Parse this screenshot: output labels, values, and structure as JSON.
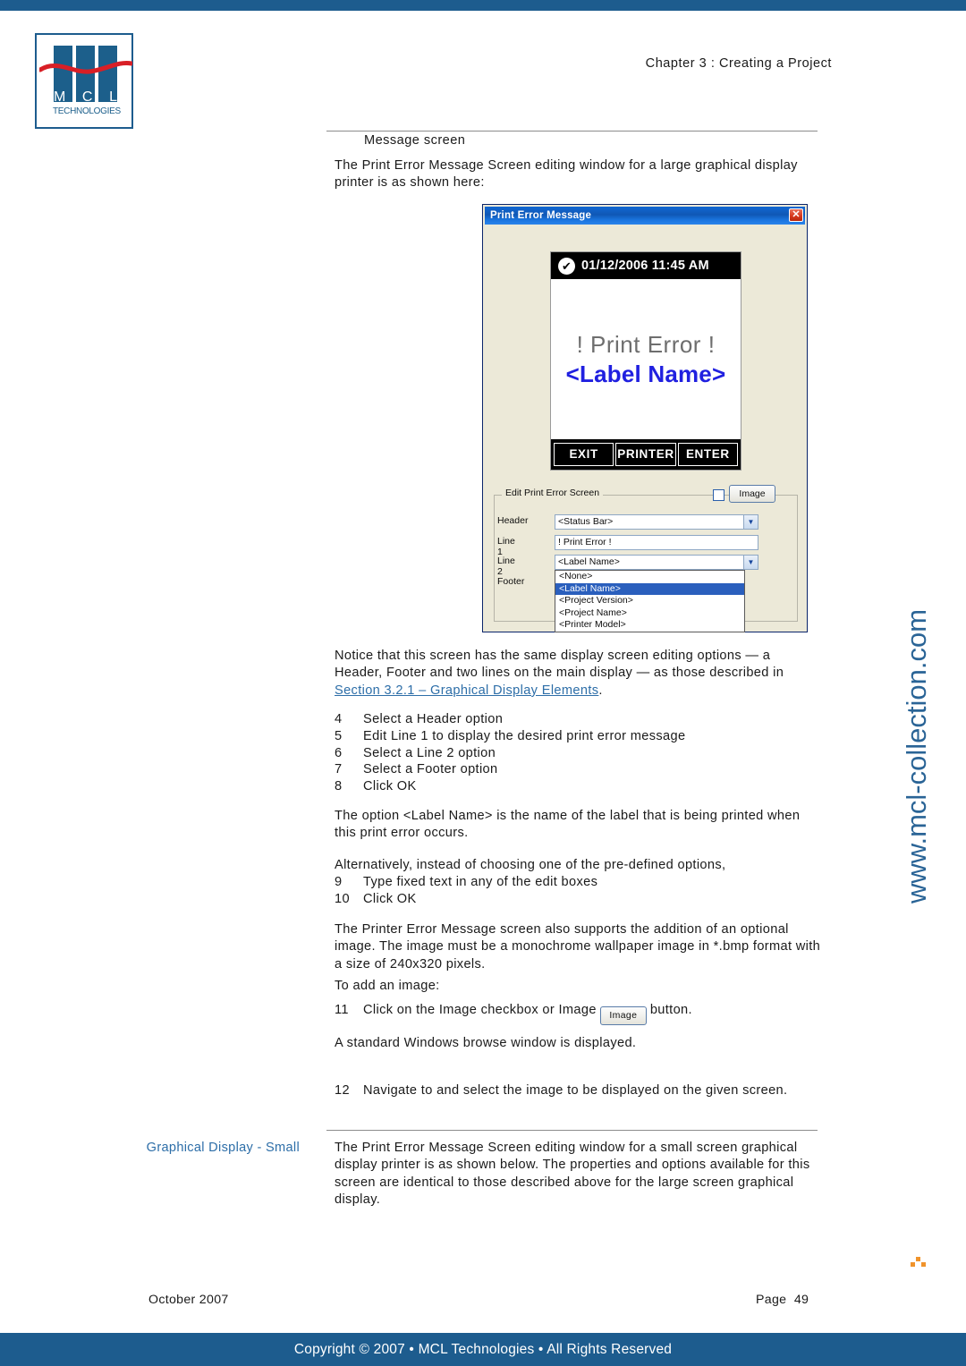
{
  "page": {
    "chapter_head": "Chapter 3 : Creating a Project",
    "sub_head": "Message screen",
    "intro": "The Print Error Message Screen editing window for a large graphical display printer is as shown here:",
    "notice_part1": "Notice that this screen has the same display screen editing options — a Header, Footer and two lines on the main display — as those described in ",
    "notice_link": "Section 3.2.1 – Graphical Display Elements",
    "notice_part2": ".",
    "label_name_para": "The option <Label Name> is the name of the label that is being printed when this print error occurs.",
    "alternatively": "Alternatively, instead of choosing one of the pre-defined options,",
    "image_para": "The Printer Error Message screen also supports the addition of an optional image. The image must be a monochrome wallpaper image in *.bmp format with a size of 240x320 pixels.",
    "to_add_image": "To add an image:",
    "browse_para": "A standard Windows browse window is displayed.",
    "side_head": "Graphical Display - Small",
    "small_screen_para": "The Print Error Message Screen editing window for a small screen graphical display printer is as shown below. The properties and options available for this screen are identical to those described above for the large screen graphical display."
  },
  "steps_first": [
    {
      "num": "4",
      "text": "Select a Header option"
    },
    {
      "num": "5",
      "text": "Edit Line 1 to display the desired print error message"
    },
    {
      "num": "6",
      "text": "Select a Line 2 option"
    },
    {
      "num": "7",
      "text": "Select a Footer option"
    },
    {
      "num": "8",
      "text": "Click OK"
    }
  ],
  "steps_second": [
    {
      "num": "9",
      "text": "Type fixed text in any of the edit boxes"
    },
    {
      "num": "10",
      "text": "Click OK"
    }
  ],
  "step_eleven": {
    "num": "11",
    "text_before": "Click on the Image checkbox or Image",
    "button_label": "Image",
    "text_after": "button."
  },
  "step_twelve": {
    "num": "12",
    "text": "Navigate to and select the image to be displayed on the given screen."
  },
  "dialog": {
    "title": "Print Error Message",
    "close_glyph": "✕",
    "screen": {
      "check_glyph": "✔",
      "datetime": "01/12/2006 11:45 AM",
      "line1": "! Print Error !",
      "line2": "<Label Name>",
      "buttons": [
        "EXIT",
        "PRINTER",
        "ENTER"
      ]
    },
    "group": {
      "legend": "Edit Print Error Screen",
      "image_button": "Image"
    },
    "fields": [
      {
        "label": "Header",
        "value": "<Status Bar>",
        "type": "combo"
      },
      {
        "label": "Line 1",
        "value": "! Print Error !",
        "type": "text"
      },
      {
        "label": "Line 2",
        "value": "<Label Name>",
        "type": "combo"
      },
      {
        "label": "Footer",
        "value": "",
        "type": "combo"
      }
    ],
    "dropdown_options": [
      {
        "label": "<None>",
        "selected": false
      },
      {
        "label": "<Label Name>",
        "selected": true
      },
      {
        "label": "<Project Version>",
        "selected": false
      },
      {
        "label": "<Project Name>",
        "selected": false
      },
      {
        "label": "<Printer Model>",
        "selected": false
      }
    ]
  },
  "logo": {
    "letters": [
      "M",
      "C",
      "L"
    ],
    "wordmark": "TECHNOLOGIES"
  },
  "footer": {
    "date": "October 2007",
    "page_label": "Page",
    "page_number": "49",
    "copyright": "Copyright © 2007 • MCL Technologies • All Rights Reserved"
  },
  "watermark": {
    "text": "www.mcl-collection.com"
  },
  "colors": {
    "brand_blue": "#1d5c8e",
    "link_blue": "#2d6ea8",
    "accent_orange": "#f0932b"
  }
}
